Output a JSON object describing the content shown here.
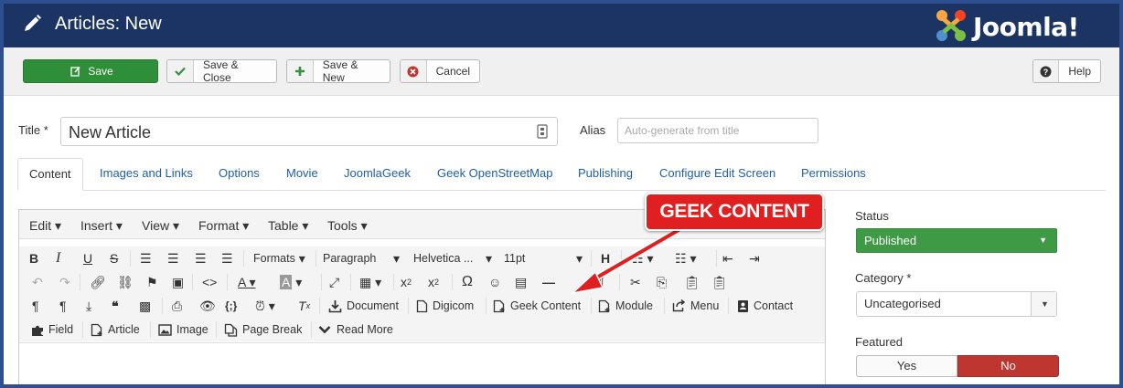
{
  "header": {
    "title": "Articles: New",
    "logo_text": "Joomla!"
  },
  "toolbar": {
    "save": "Save",
    "save_close": "Save & Close",
    "save_new": "Save & New",
    "cancel": "Cancel",
    "help": "Help"
  },
  "form": {
    "title_label": "Title *",
    "title_value": "New Article",
    "alias_label": "Alias",
    "alias_placeholder": "Auto-generate from title"
  },
  "tabs": [
    "Content",
    "Images and Links",
    "Options",
    "Movie",
    "JoomlaGeek",
    "Geek OpenStreetMap",
    "Publishing",
    "Configure Edit Screen",
    "Permissions"
  ],
  "editor": {
    "menus": [
      "Edit",
      "Insert",
      "View",
      "Format",
      "Table",
      "Tools"
    ],
    "formats_label": "Formats",
    "paragraph_label": "Paragraph",
    "font_label": "Helvetica ...",
    "size_label": "11pt",
    "plugin_buttons": {
      "document": "Document",
      "digicom": "Digicom",
      "geek_content": "Geek Content",
      "module": "Module",
      "menu": "Menu",
      "contact": "Contact",
      "field": "Field",
      "article": "Article",
      "image": "Image",
      "page_break": "Page Break",
      "read_more": "Read More"
    }
  },
  "sidebar": {
    "status_label": "Status",
    "status_value": "Published",
    "category_label": "Category *",
    "category_value": "Uncategorised",
    "featured_label": "Featured",
    "featured_yes": "Yes",
    "featured_no": "No"
  },
  "annotation": {
    "callout": "GEEK CONTENT"
  },
  "colors": {
    "header": "#1b3464",
    "save_green": "#2f8e38",
    "published_green": "#3f9a45",
    "no_red": "#bd362f",
    "callout_red": "#e02020",
    "link_blue": "#1f5fa8"
  }
}
